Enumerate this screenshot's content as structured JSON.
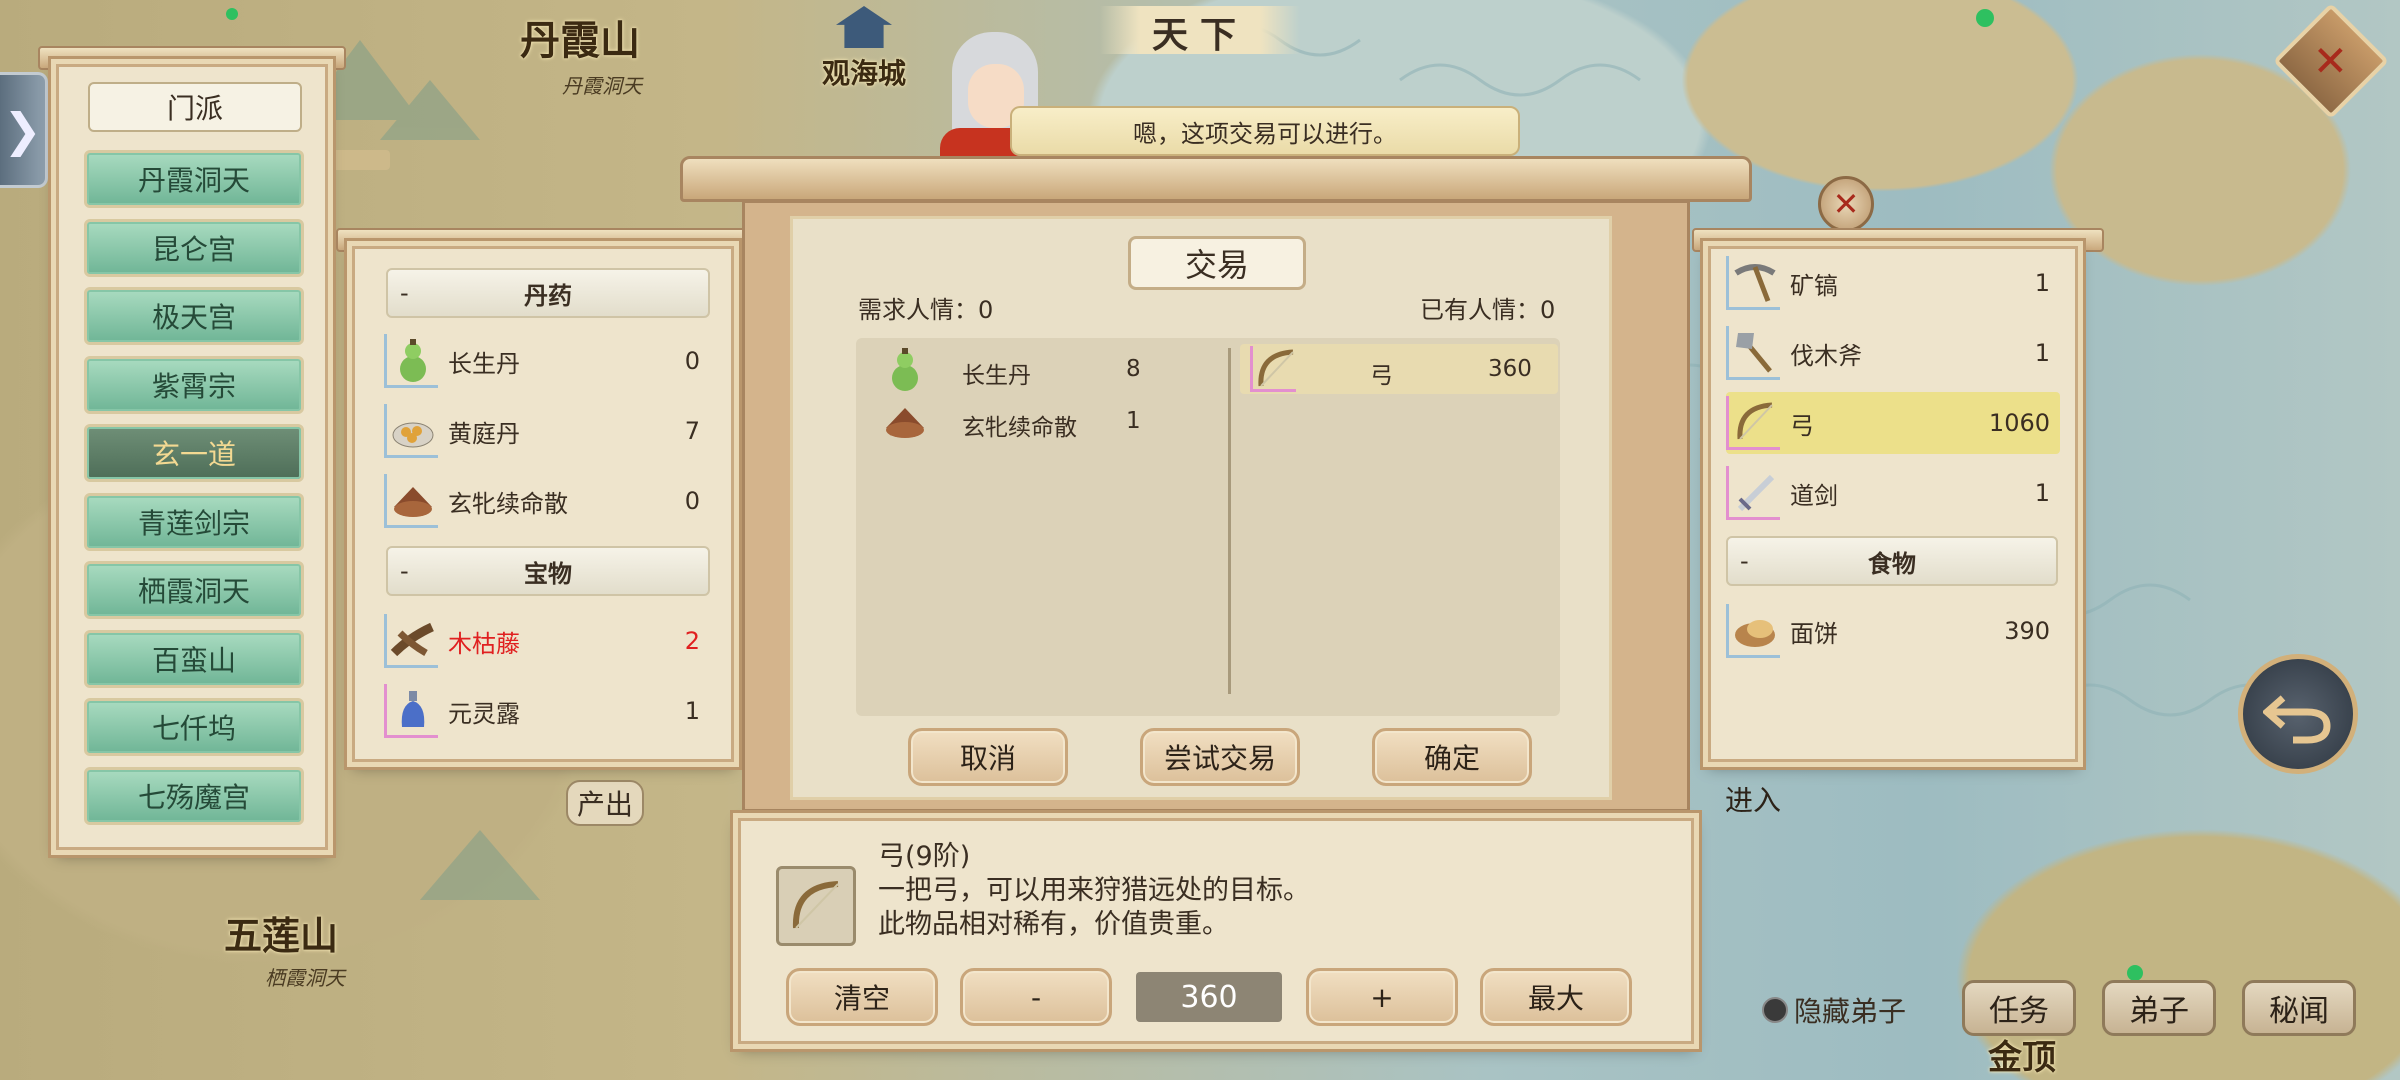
{
  "map": {
    "region_title": "天下",
    "places": [
      {
        "name": "丹霞山",
        "sub": "丹霞洞天"
      },
      {
        "name": "观海城"
      },
      {
        "name": "五莲山",
        "sub": "栖霞洞天"
      },
      {
        "name": "金顶"
      }
    ],
    "produce_label": "产出",
    "enter_label": "进入"
  },
  "dialog": {
    "text": "嗯，这项交易可以进行。"
  },
  "sect_panel": {
    "title": "门派",
    "sects": [
      "丹霞洞天",
      "昆仑宫",
      "极天宫",
      "紫霄宗",
      "玄一道",
      "青莲剑宗",
      "栖霞洞天",
      "百蛮山",
      "七仟坞",
      "七殇魔宫"
    ],
    "selected": "玄一道"
  },
  "left_inventory": {
    "groups": [
      {
        "dash": "-",
        "name": "丹药",
        "items": [
          {
            "name": "长生丹",
            "qty": "0",
            "icon": "gourd-icon"
          },
          {
            "name": "黄庭丹",
            "qty": "7",
            "icon": "pill-plate-icon"
          },
          {
            "name": "玄牝续命散",
            "qty": "0",
            "icon": "powder-bowl-icon"
          }
        ]
      },
      {
        "dash": "-",
        "name": "宝物",
        "items": [
          {
            "name": "木枯藤",
            "qty": "2",
            "icon": "vine-icon",
            "highlight": "#e02020"
          },
          {
            "name": "元灵露",
            "qty": "1",
            "icon": "vial-icon"
          }
        ]
      }
    ]
  },
  "trade": {
    "title": "交易",
    "required_label": "需求人情：0",
    "owned_label": "已有人情：0",
    "give": [
      {
        "name": "长生丹",
        "qty": "8",
        "icon": "gourd-icon"
      },
      {
        "name": "玄牝续命散",
        "qty": "1",
        "icon": "powder-bowl-icon"
      }
    ],
    "get": [
      {
        "name": "弓",
        "qty": "360",
        "icon": "bow-icon"
      }
    ],
    "buttons": {
      "cancel": "取消",
      "try": "尝试交易",
      "confirm": "确定"
    }
  },
  "right_inventory": {
    "items": [
      {
        "name": "矿镐",
        "qty": "1",
        "icon": "pickaxe-icon"
      },
      {
        "name": "伐木斧",
        "qty": "1",
        "icon": "axe-icon"
      },
      {
        "name": "弓",
        "qty": "1060",
        "icon": "bow-icon",
        "selected": true
      },
      {
        "name": "道剑",
        "qty": "1",
        "icon": "sword-icon"
      }
    ],
    "group": {
      "dash": "-",
      "name": "食物"
    },
    "food": [
      {
        "name": "面饼",
        "qty": "390",
        "icon": "bread-icon"
      }
    ]
  },
  "detail": {
    "name": "弓(9阶)",
    "line1": "一把弓，可以用来狩猎远处的目标。",
    "line2": "此物品相对稀有，价值贵重。",
    "clear": "清空",
    "minus": "-",
    "amount": "360",
    "plus": "+",
    "max": "最大"
  },
  "bottom_right": {
    "hide_disciples": "隐藏弟子",
    "tasks": "任务",
    "disciples": "弟子",
    "secrets": "秘闻"
  },
  "colors": {
    "jade": "#8ccaaa",
    "selected_row": "#ece08a",
    "panel": "#eee4cc",
    "rare_text": "#e02020"
  }
}
